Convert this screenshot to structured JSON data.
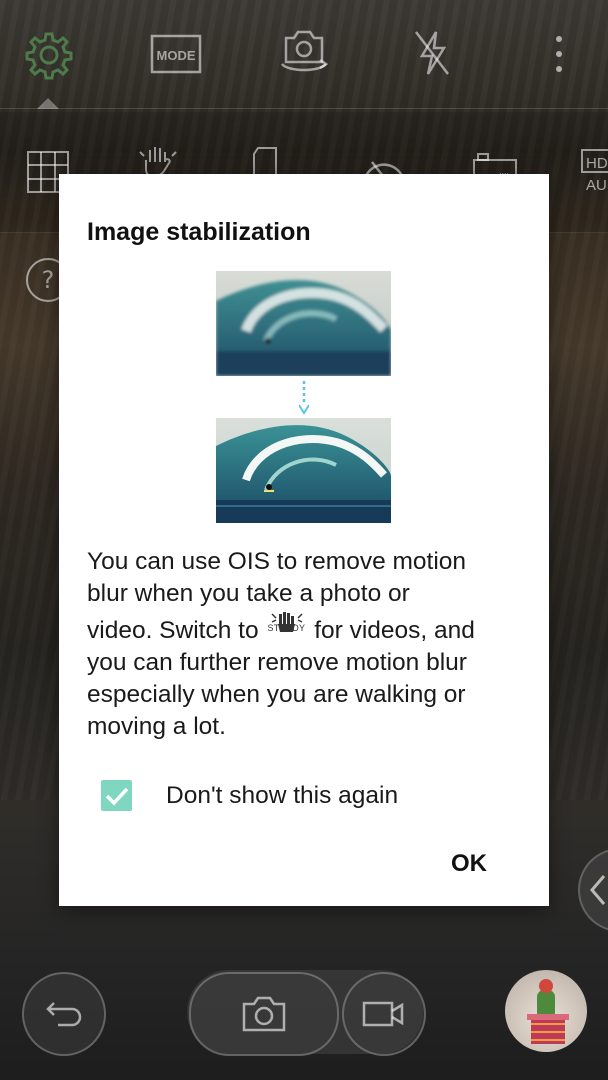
{
  "dialog": {
    "title": "Image stabilization",
    "desc_line1": "You can use OIS to remove motion",
    "desc_line2": "blur when you take a photo or",
    "desc_line3_pre": "video. Switch to",
    "desc_line3_post": "for videos, and",
    "desc_line4": "you can further remove motion blur",
    "desc_line5": "especially when you are walking or",
    "desc_line6": "moving a lot.",
    "steady_label": "STEADY",
    "checkbox_label": "Don't show this again",
    "checkbox_checked": true,
    "ok_label": "OK"
  },
  "topbar": {
    "icons": [
      "settings-icon",
      "mode-icon",
      "switch-camera-icon",
      "flash-off-icon",
      "more-icon"
    ],
    "mode_label": "MODE"
  },
  "secondbar": {
    "icons": [
      "grid-icon",
      "steady-icon",
      "sd-card-icon",
      "timer-icon",
      "tag-icon",
      "hdr-auto-icon"
    ],
    "hdr_label": "HD",
    "auto_label": "AU"
  },
  "colors": {
    "checkbox_accent": "#7fd6c1",
    "dialog_bg": "#ffffff",
    "arrow": "#5bc4e8"
  }
}
